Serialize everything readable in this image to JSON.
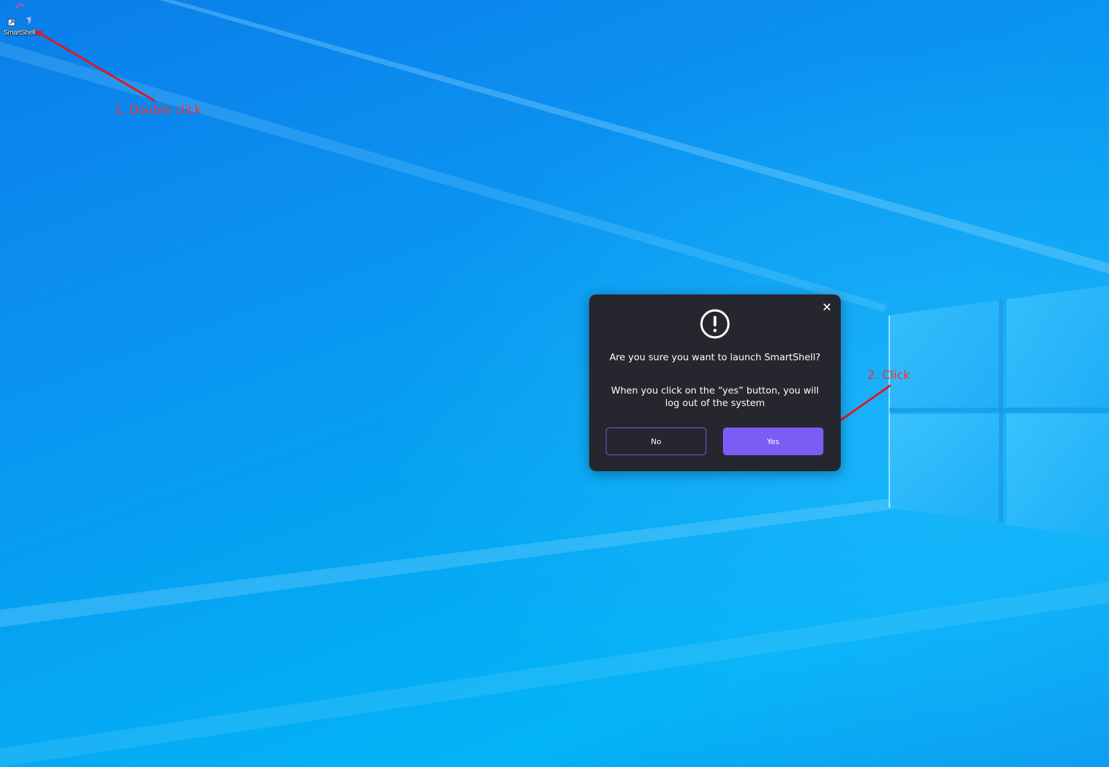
{
  "desktop": {
    "icons": [
      {
        "label": "SmartShell",
        "icon": "smartshell-shortcut-icon"
      }
    ]
  },
  "annotations": [
    {
      "text": "1. Double click",
      "color": "#ff2a2a"
    },
    {
      "text": "2. Click",
      "color": "#ff2a2a"
    }
  ],
  "dialog": {
    "question": "Are you sure you want to launch SmartShell?",
    "warning": "When you click on the “yes” button, you will log out of the system",
    "no_label": "No",
    "yes_label": "Yes",
    "icons": {
      "alert": "exclamation-circle-icon",
      "close": "close-icon"
    },
    "colors": {
      "background": "#26262e",
      "accent": "#7b5cf5"
    }
  }
}
